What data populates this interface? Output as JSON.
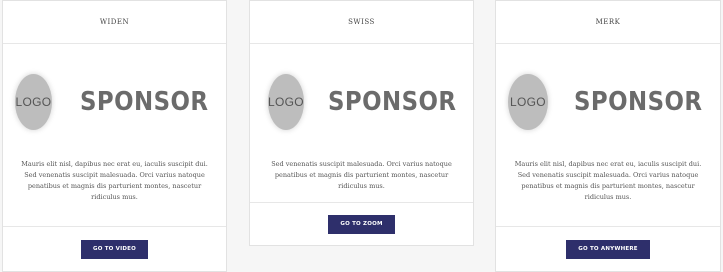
{
  "cards": [
    {
      "title": "WIDEN",
      "logo": "LOGO",
      "sponsor": "SPONSOR",
      "description": "Mauris elit nisl, dapibus nec erat eu, iaculis suscipit dui. Sed venenatis suscipit malesuada. Orci varius natoque penatibus et magnis dis parturient montes, nascetur ridiculus mus.",
      "cta": "GO TO VIDEO"
    },
    {
      "title": "SWISS",
      "logo": "LOGO",
      "sponsor": "SPONSOR",
      "description": "Sed venenatis suscipit malesuada. Orci varius natoque penatibus et magnis dis parturient montes, nascetur ridiculus mus.",
      "cta": "GO TO ZOOM"
    },
    {
      "title": "MERK",
      "logo": "LOGO",
      "sponsor": "SPONSOR",
      "description": "Mauris elit nisl, dapibus nec erat eu, iaculis suscipit dui. Sed venenatis suscipit malesuada. Orci varius natoque penatibus et magnis dis parturient montes, nascetur ridiculus mus.",
      "cta": "GO TO ANYWHERE"
    }
  ],
  "colors": {
    "button": "#2e2f6b",
    "logo_circle": "#bdbdbd",
    "sponsor_text": "#6b6b6b"
  }
}
